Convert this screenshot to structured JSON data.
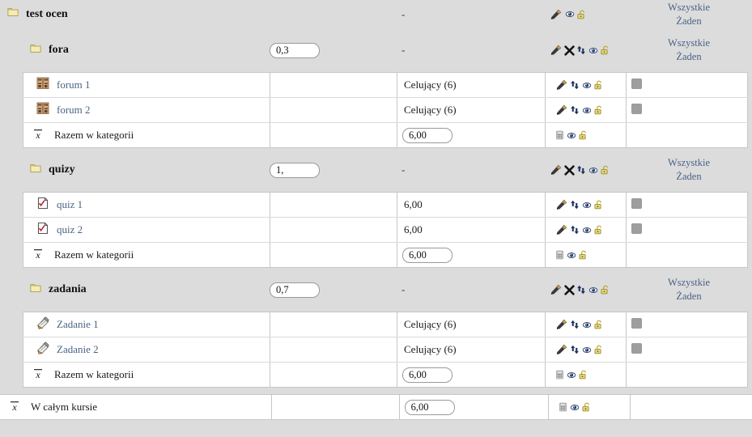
{
  "page": {
    "title": "test ocen",
    "root_weight": "",
    "root_value": "-"
  },
  "labels": {
    "select_all": "Wszystkie",
    "select_none": "Żaden",
    "category_total": "Razem w kategorii",
    "course_total": "W całym kursie",
    "dash": "-"
  },
  "icons": {
    "folder": "folder-icon",
    "forum": "forum-icon",
    "quiz": "quiz-icon",
    "assignment": "assignment-icon",
    "aggregation": "x-bar-mean-icon",
    "edit": "edit-icon",
    "delete": "delete-x-icon",
    "move": "move-updown-icon",
    "hide": "eye-hide-icon",
    "lock": "padlock-unlocked-icon",
    "calculator": "calculator-icon"
  },
  "colors": {
    "background": "#dcdcdc",
    "row_background": "#ffffff",
    "link": "#4a6285",
    "border": "#c6c6c6",
    "checkbox_disabled": "#9e9e9e",
    "folder": "#f2e6a8",
    "lock": "#c8b432"
  },
  "root": {
    "name": "test ocen",
    "weight": "",
    "value": "-",
    "actions": [
      "edit",
      "hide",
      "lock"
    ],
    "select_all": "Wszystkie",
    "select_none": "Żaden"
  },
  "categories": [
    {
      "name": "fora",
      "weight": "0,3",
      "value": "-",
      "actions": [
        "edit",
        "delete",
        "move",
        "hide",
        "lock"
      ],
      "select_all": "Wszystkie",
      "select_none": "Żaden",
      "items": [
        {
          "icon": "forum-icon",
          "name": "forum 1",
          "weight": "",
          "value": "Celujący (6)",
          "value_kind": "text",
          "actions": [
            "edit",
            "move",
            "hide",
            "lock"
          ],
          "checkbox": true
        },
        {
          "icon": "forum-icon",
          "name": "forum 2",
          "weight": "",
          "value": "Celujący (6)",
          "value_kind": "text",
          "actions": [
            "edit",
            "move",
            "hide",
            "lock"
          ],
          "checkbox": true
        }
      ],
      "total": {
        "label": "Razem w kategorii",
        "value": "6,00",
        "value_kind": "input",
        "actions": [
          "calculator",
          "hide",
          "lock"
        ]
      }
    },
    {
      "name": "quizy",
      "weight": "1,",
      "value": "-",
      "actions": [
        "edit",
        "delete",
        "move",
        "hide",
        "lock"
      ],
      "select_all": "Wszystkie",
      "select_none": "Żaden",
      "items": [
        {
          "icon": "quiz-icon",
          "name": "quiz 1",
          "weight": "",
          "value": "6,00",
          "value_kind": "text",
          "actions": [
            "edit",
            "move",
            "hide",
            "lock"
          ],
          "checkbox": true
        },
        {
          "icon": "quiz-icon",
          "name": "quiz 2",
          "weight": "",
          "value": "6,00",
          "value_kind": "text",
          "actions": [
            "edit",
            "move",
            "hide",
            "lock"
          ],
          "checkbox": true
        }
      ],
      "total": {
        "label": "Razem w kategorii",
        "value": "6,00",
        "value_kind": "input",
        "actions": [
          "calculator",
          "hide",
          "lock"
        ]
      }
    },
    {
      "name": "zadania",
      "weight": "0,7",
      "value": "-",
      "actions": [
        "edit",
        "delete",
        "move",
        "hide",
        "lock"
      ],
      "select_all": "Wszystkie",
      "select_none": "Żaden",
      "items": [
        {
          "icon": "assignment-icon",
          "name": "Zadanie 1",
          "weight": "",
          "value": "Celujący (6)",
          "value_kind": "text",
          "actions": [
            "edit",
            "move",
            "hide",
            "lock"
          ],
          "checkbox": true
        },
        {
          "icon": "assignment-icon",
          "name": "Zadanie 2",
          "weight": "",
          "value": "Celujący (6)",
          "value_kind": "text",
          "actions": [
            "edit",
            "move",
            "hide",
            "lock"
          ],
          "checkbox": true
        }
      ],
      "total": {
        "label": "Razem w kategorii",
        "value": "6,00",
        "value_kind": "input",
        "actions": [
          "calculator",
          "hide",
          "lock"
        ]
      }
    }
  ],
  "course_total": {
    "label": "W całym kursie",
    "weight": "",
    "value": "6,00",
    "value_kind": "input",
    "actions": [
      "calculator",
      "hide",
      "lock"
    ]
  }
}
